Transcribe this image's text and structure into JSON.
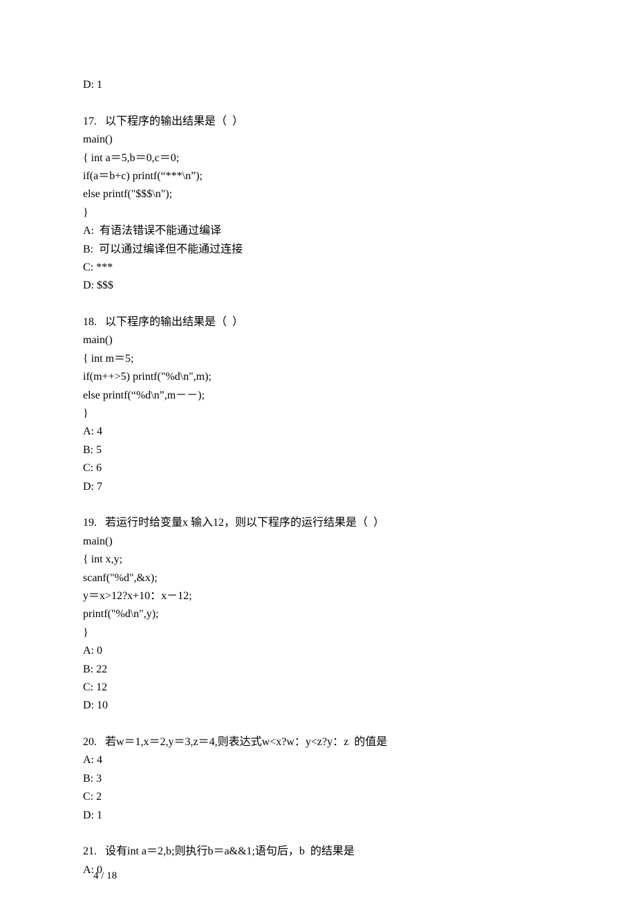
{
  "lines": [
    "D: 1",
    "",
    "17.   以下程序的输出结果是（  ）",
    "main()",
    "{ int a＝5,b＝0,c＝0;",
    "if(a＝b+c) printf(“***\\n”);",
    "else printf(\"$$$\\n\");",
    "}",
    "A:  有语法错误不能通过编译",
    "B:  可以通过编译但不能通过连接",
    "C: ***",
    "D: $$$",
    "",
    "18.   以下程序的输出结果是（  ）",
    "main()",
    "{ int m＝5;",
    "if(m++>5) printf(\"%d\\n\",m);",
    "else printf(“%d\\n”,m－－);",
    "}",
    "A: 4",
    "B: 5",
    "C: 6",
    "D: 7",
    "",
    "19.   若运行时给变量x 输入12，则以下程序的运行结果是（  ）",
    "main()",
    "{ int x,y;",
    "scanf(\"%d\",&x);",
    "y＝x>12?x+10：x－12;",
    "printf(\"%d\\n\",y);",
    "}",
    "A: 0",
    "B: 22",
    "C: 12",
    "D: 10",
    "",
    "20.   若w＝1,x＝2,y＝3,z＝4,则表达式w<x?w：y<z?y：z  的值是",
    "A: 4",
    "B: 3",
    "C: 2",
    "D: 1",
    "",
    "21.   设有int a＝2,b;则执行b＝a&&1;语句后，b  的结果是",
    "A: 0"
  ],
  "footer": {
    "page": "4 / 18"
  }
}
